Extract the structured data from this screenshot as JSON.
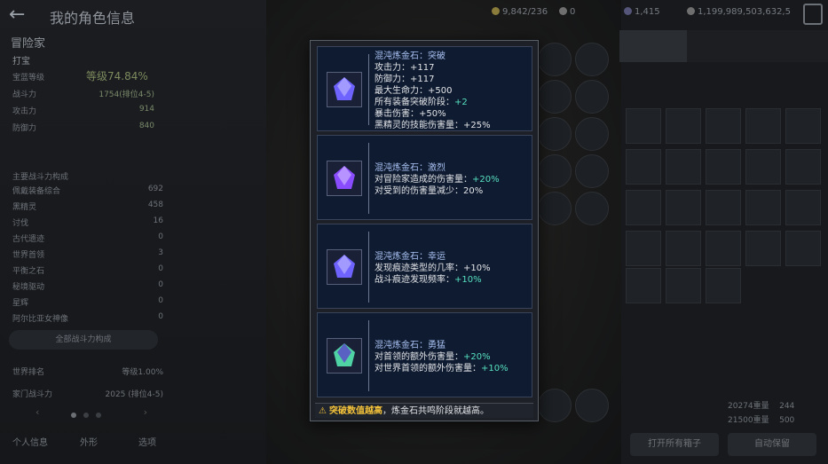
{
  "header": {
    "back_icon": "arrow-left-icon",
    "title": "我的角色信息",
    "resources": [
      {
        "name": "coin-icon",
        "value": "9,842/236",
        "color": "#9a8a3c"
      },
      {
        "name": "gem-icon",
        "value": "0",
        "color": "#8a8a8a"
      },
      {
        "name": "crystal-icon",
        "value": "1,415",
        "color": "#6a6a8a"
      },
      {
        "name": "silver-icon",
        "value": "1,199,989,503,632,5",
        "color": "#8a8a8a"
      }
    ]
  },
  "left_panel": {
    "class_name": "冒险家",
    "sub": "打宝",
    "level_label": "等级74.84%",
    "rows": [
      {
        "label": "宝蓝等级",
        "value": ""
      },
      {
        "label": "战斗力",
        "value": "1754(排位4-5)"
      },
      {
        "label": "攻击力",
        "value": "914"
      },
      {
        "label": "防御力",
        "value": "840"
      }
    ],
    "section_title": "主要战斗力构成",
    "stats": [
      {
        "label": "佩戴装备综合",
        "value": "692"
      },
      {
        "label": "黑精灵",
        "value": "458"
      },
      {
        "label": "讨伐",
        "value": "16"
      },
      {
        "label": "古代遗迹",
        "value": "0"
      },
      {
        "label": "世界首领",
        "value": "3"
      },
      {
        "label": "平衡之石",
        "value": "0"
      },
      {
        "label": "秘境驱动",
        "value": "0"
      },
      {
        "label": "星辉",
        "value": "0"
      },
      {
        "label": "阿尔比亚女神像",
        "value": "0"
      }
    ],
    "all_button": "全部战斗力构成",
    "world_label": "世界排名",
    "world_value": "等级1.00%",
    "family_label": "家门战斗力",
    "family_value": "2025 (排位4-5)",
    "tabs": [
      "个人信息",
      "外形",
      "选项"
    ]
  },
  "right_panel": {
    "open_all_button": "打开所有箱子",
    "auto_sell_button": "自动保留",
    "weights": [
      {
        "label": "20274重量",
        "value": "244"
      },
      {
        "label": "21500重量",
        "value": "500"
      }
    ]
  },
  "modal": {
    "cards": [
      {
        "title": "混沌炼金石：突破",
        "gem_color": "#6f63ff",
        "lines": [
          {
            "text": "攻击力：+117"
          },
          {
            "text": "防御力：+117"
          },
          {
            "text": "最大生命力：+500"
          },
          {
            "text": "所有装备突破阶段：",
            "hl": "+2"
          },
          {
            "text": "暴击伤害：+50%"
          },
          {
            "text": "黑精灵的技能伤害量：+25%"
          }
        ]
      },
      {
        "title": "混沌炼金石：激烈",
        "gem_color": "#8a4cff",
        "lines": [
          {
            "text": "对冒险家造成的伤害量：",
            "hl": "+20%"
          },
          {
            "text": "对受到的伤害量减少：20%"
          }
        ]
      },
      {
        "title": "混沌炼金石：幸运",
        "gem_color": "#6f63ff",
        "lines": [
          {
            "text": "发现痕迹类型的几率：+10%"
          },
          {
            "text": "战斗痕迹发现频率：",
            "hl": "+10%"
          }
        ]
      },
      {
        "title": "混沌炼金石：勇猛",
        "gem_color": "#4fd3a4",
        "lines": [
          {
            "text": "对首领的额外伤害量：",
            "hl": "+20%"
          },
          {
            "text": "对世界首领的额外伤害量：",
            "hl": "+10%"
          }
        ]
      }
    ],
    "footer": {
      "warn_icon": "warning-icon",
      "warn_text": "突破数值越高",
      "rest_text": "，炼金石共鸣阶段就越高。"
    }
  }
}
